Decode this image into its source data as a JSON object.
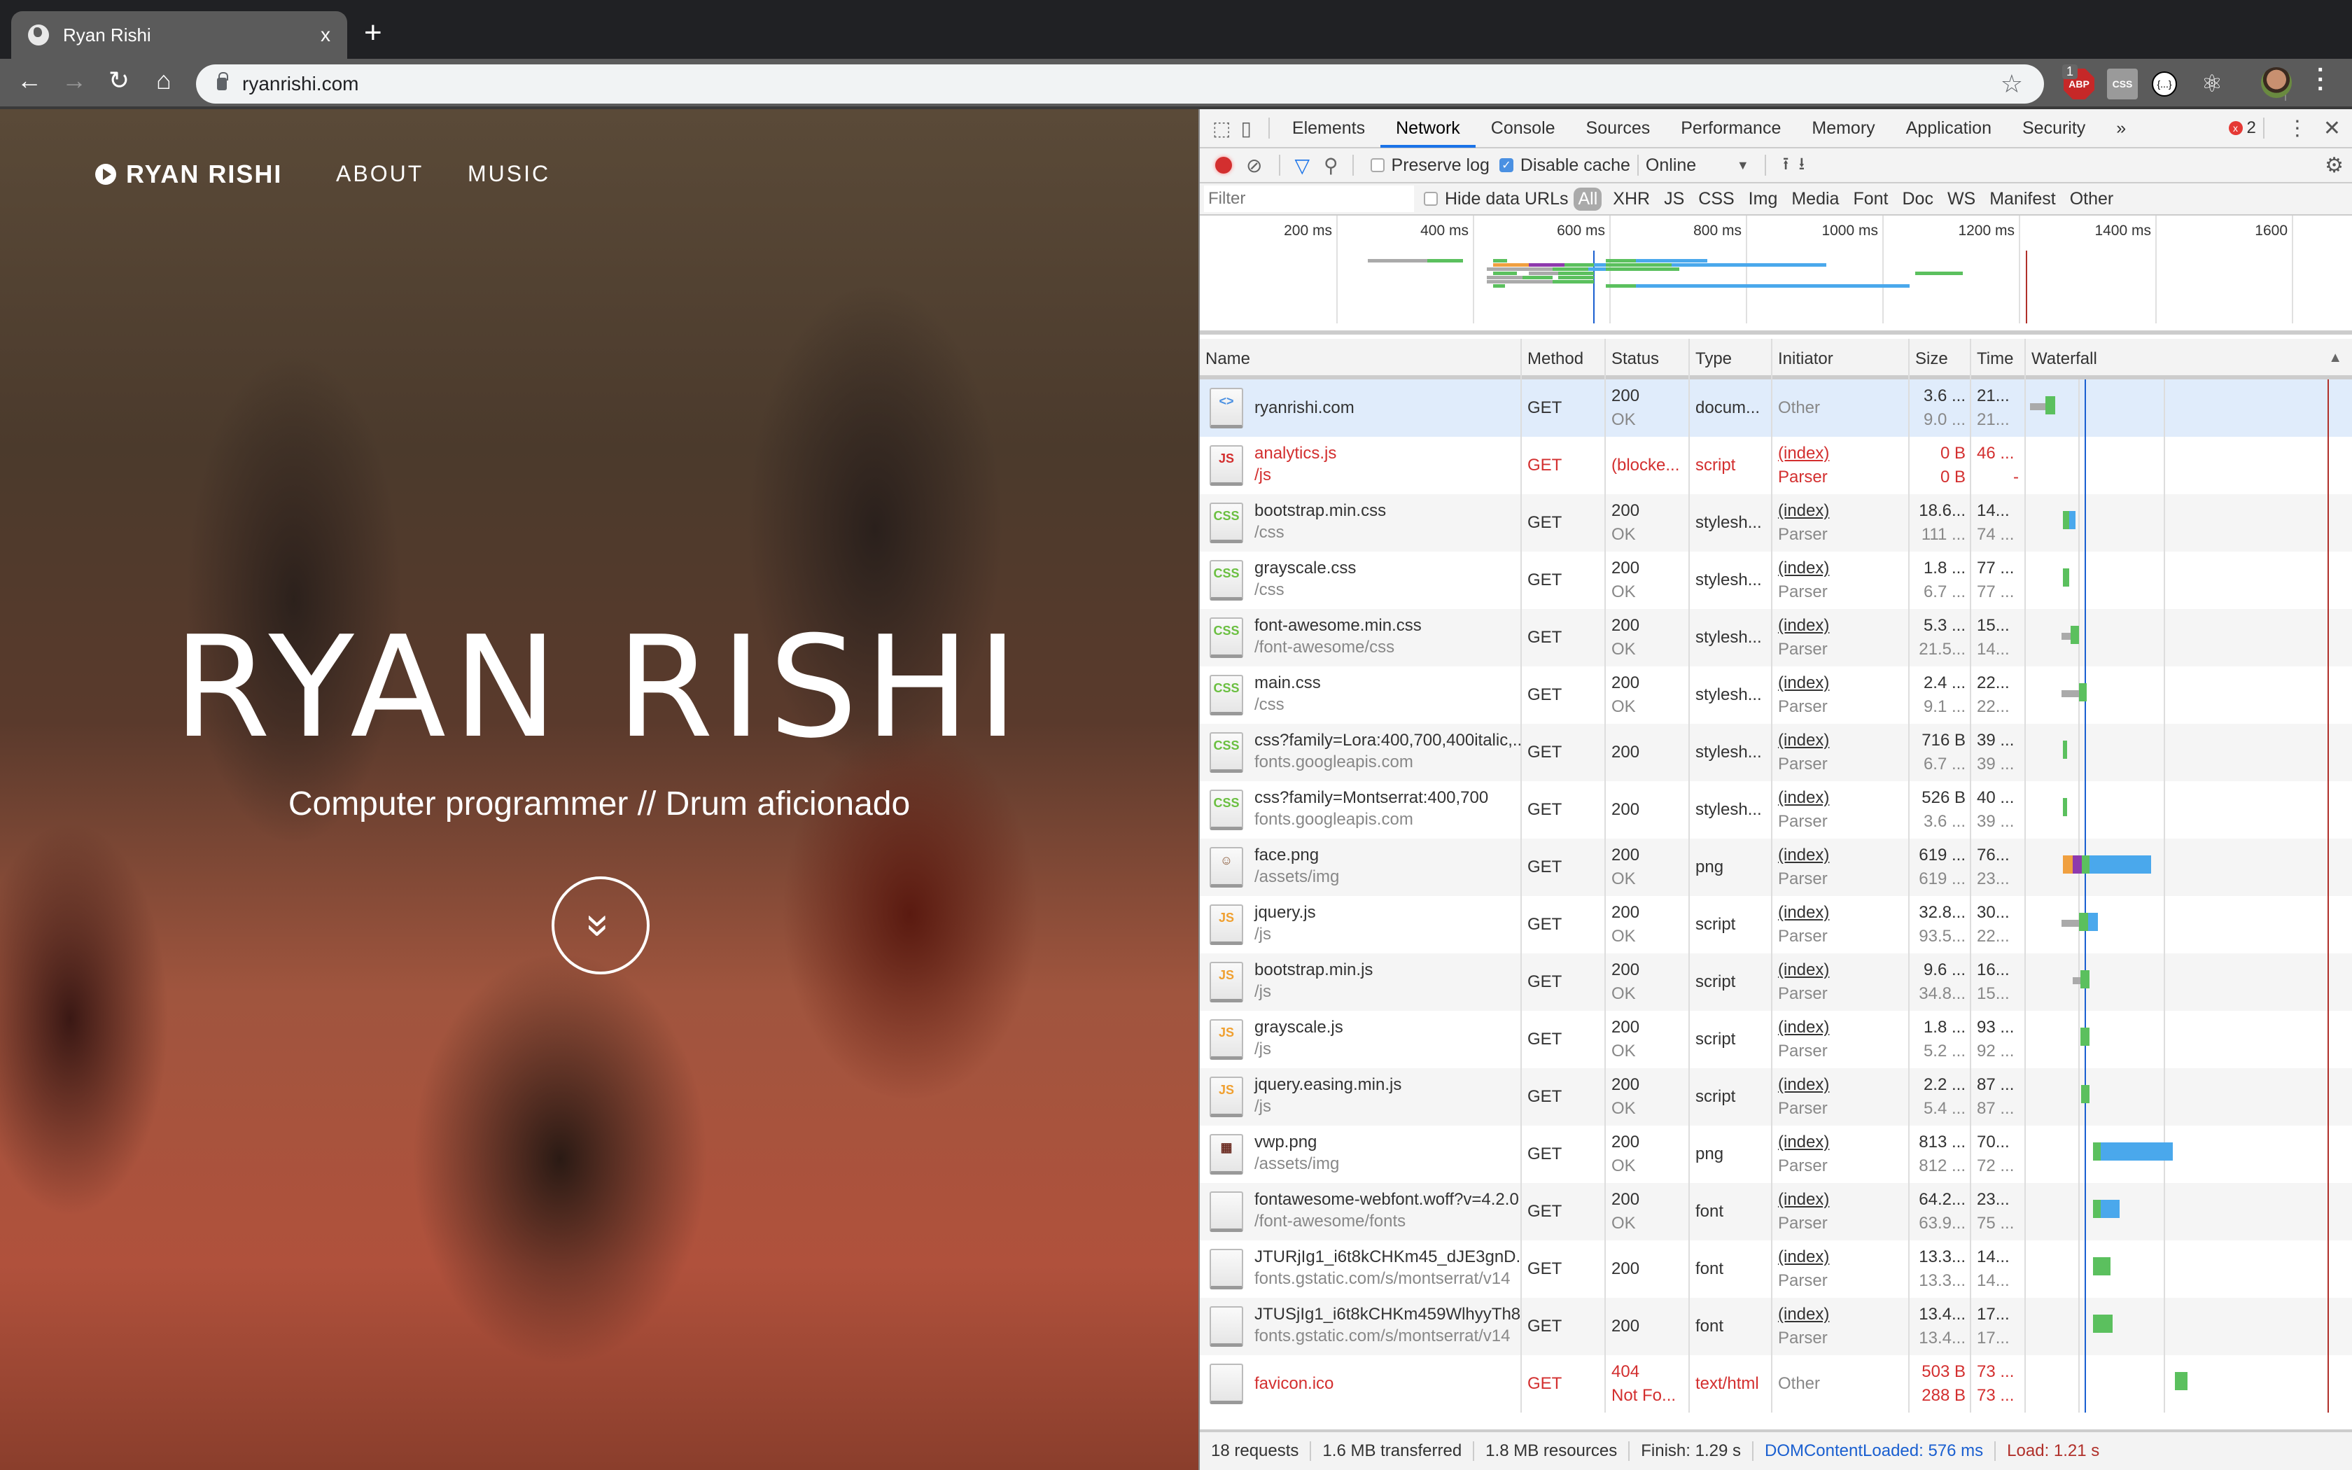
{
  "browser": {
    "tab_title": "Ryan Rishi",
    "new_tab": "+",
    "tab_close": "x",
    "url": "ryanrishi.com",
    "nav": {
      "back": "←",
      "forward": "→",
      "reload": "↻",
      "home": "⌂"
    },
    "extensions": {
      "abp_label": "ABP",
      "abp_badge": "1",
      "css_label": "CSS",
      "json_label": "{...}",
      "react_label": "⚛"
    },
    "bookmark_star": "☆",
    "menu": "⋮"
  },
  "page": {
    "brand": "RYAN RISHI",
    "nav_links": [
      "ABOUT",
      "MUSIC"
    ],
    "hero_title": "RYAN RISHI",
    "hero_subtitle": "Computer programmer // Drum aficionado",
    "scroll_icon": "»"
  },
  "devtools": {
    "tabs": [
      "Elements",
      "Network",
      "Console",
      "Sources",
      "Performance",
      "Memory",
      "Application",
      "Security"
    ],
    "active_tab": "Network",
    "more_tabs": "»",
    "error_count": "2",
    "toolbar": {
      "preserve_log": "Preserve log",
      "preserve_log_checked": false,
      "disable_cache": "Disable cache",
      "disable_cache_checked": true,
      "throttle": "Online"
    },
    "filter": {
      "placeholder": "Filter",
      "hide_data_urls": "Hide data URLs",
      "types": [
        "All",
        "XHR",
        "JS",
        "CSS",
        "Img",
        "Media",
        "Font",
        "Doc",
        "WS",
        "Manifest",
        "Other"
      ],
      "active_type": "All"
    },
    "overview": {
      "ticks": [
        "200 ms",
        "400 ms",
        "600 ms",
        "800 ms",
        "1000 ms",
        "1200 ms",
        "1400 ms",
        "1600"
      ],
      "dom_content_loaded_ms": 576,
      "load_ms": 1210
    },
    "columns": [
      "Name",
      "Method",
      "Status",
      "Type",
      "Initiator",
      "Size",
      "Time",
      "Waterfall"
    ],
    "requests": [
      {
        "name": "ryanrishi.com",
        "path": "",
        "method": "GET",
        "status": "200",
        "status_text": "OK",
        "type": "docum...",
        "initiator": "Other",
        "initiator_sub": "",
        "size": "3.6 ...",
        "size2": "9.0 ...",
        "time": "21...",
        "time2": "21...",
        "icon": "doc",
        "error": false,
        "selected": true,
        "wf": [
          [
            0,
            0.05,
            "#aaa"
          ],
          [
            0.05,
            0.08,
            "#5bc05e"
          ]
        ]
      },
      {
        "name": "analytics.js",
        "path": "/js",
        "method": "GET",
        "status": "(blocke...",
        "status_text": "",
        "type": "script",
        "initiator": "(index)",
        "initiator_sub": "Parser",
        "size": "0 B",
        "size2": "0 B",
        "time": "46 ...",
        "time2": "-",
        "icon": "js",
        "error": true,
        "wf": []
      },
      {
        "name": "bootstrap.min.css",
        "path": "/css",
        "method": "GET",
        "status": "200",
        "status_text": "OK",
        "type": "stylesh...",
        "initiator": "(index)",
        "initiator_sub": "Parser",
        "size": "18.6...",
        "size2": "111 ...",
        "time": "14...",
        "time2": "74 ...",
        "icon": "css",
        "error": false,
        "wf": [
          [
            0.105,
            0.125,
            "#5bc05e"
          ],
          [
            0.125,
            0.145,
            "#4aa8ec"
          ]
        ]
      },
      {
        "name": "grayscale.css",
        "path": "/css",
        "method": "GET",
        "status": "200",
        "status_text": "OK",
        "type": "stylesh...",
        "initiator": "(index)",
        "initiator_sub": "Parser",
        "size": "1.8 ...",
        "size2": "6.7 ...",
        "time": "77 ...",
        "time2": "77 ...",
        "icon": "css",
        "error": false,
        "wf": [
          [
            0.105,
            0.125,
            "#5bc05e"
          ]
        ]
      },
      {
        "name": "font-awesome.min.css",
        "path": "/font-awesome/css",
        "method": "GET",
        "status": "200",
        "status_text": "OK",
        "type": "stylesh...",
        "initiator": "(index)",
        "initiator_sub": "Parser",
        "size": "5.3 ...",
        "size2": "21.5...",
        "time": "15...",
        "time2": "14...",
        "icon": "css",
        "error": false,
        "wf": [
          [
            0.1,
            0.13,
            "#aaa"
          ],
          [
            0.13,
            0.155,
            "#5bc05e"
          ]
        ]
      },
      {
        "name": "main.css",
        "path": "/css",
        "method": "GET",
        "status": "200",
        "status_text": "OK",
        "type": "stylesh...",
        "initiator": "(index)",
        "initiator_sub": "Parser",
        "size": "2.4 ...",
        "size2": "9.1 ...",
        "time": "22...",
        "time2": "22...",
        "icon": "css",
        "error": false,
        "wf": [
          [
            0.1,
            0.155,
            "#aaa"
          ],
          [
            0.155,
            0.18,
            "#5bc05e"
          ]
        ]
      },
      {
        "name": "css?family=Lora:400,700,400italic,...",
        "path": "fonts.googleapis.com",
        "method": "GET",
        "status": "200",
        "status_text": "",
        "type": "stylesh...",
        "initiator": "(index)",
        "initiator_sub": "Parser",
        "size": "716 B",
        "size2": "6.7 ...",
        "time": "39 ...",
        "time2": "39 ...",
        "icon": "css",
        "error": false,
        "wf": [
          [
            0.105,
            0.115,
            "#5bc05e"
          ]
        ]
      },
      {
        "name": "css?family=Montserrat:400,700",
        "path": "fonts.googleapis.com",
        "method": "GET",
        "status": "200",
        "status_text": "",
        "type": "stylesh...",
        "initiator": "(index)",
        "initiator_sub": "Parser",
        "size": "526 B",
        "size2": "3.6 ...",
        "time": "40 ...",
        "time2": "39 ...",
        "icon": "css",
        "error": false,
        "wf": [
          [
            0.105,
            0.117,
            "#5bc05e"
          ]
        ]
      },
      {
        "name": "face.png",
        "path": "/assets/img",
        "method": "GET",
        "status": "200",
        "status_text": "OK",
        "type": "png",
        "initiator": "(index)",
        "initiator_sub": "Parser",
        "size": "619 ...",
        "size2": "619 ...",
        "time": "76...",
        "time2": "23...",
        "icon": "face",
        "error": false,
        "wf": [
          [
            0.105,
            0.135,
            "#f0a040"
          ],
          [
            0.135,
            0.165,
            "#8e3aad"
          ],
          [
            0.165,
            0.19,
            "#5bc05e"
          ],
          [
            0.19,
            0.385,
            "#4aa8ec"
          ]
        ]
      },
      {
        "name": "jquery.js",
        "path": "/js",
        "method": "GET",
        "status": "200",
        "status_text": "OK",
        "type": "script",
        "initiator": "(index)",
        "initiator_sub": "Parser",
        "size": "32.8...",
        "size2": "93.5...",
        "time": "30...",
        "time2": "22...",
        "icon": "js",
        "error": false,
        "wf": [
          [
            0.1,
            0.155,
            "#aaa"
          ],
          [
            0.155,
            0.185,
            "#5bc05e"
          ],
          [
            0.185,
            0.215,
            "#4aa8ec"
          ]
        ]
      },
      {
        "name": "bootstrap.min.js",
        "path": "/js",
        "method": "GET",
        "status": "200",
        "status_text": "OK",
        "type": "script",
        "initiator": "(index)",
        "initiator_sub": "Parser",
        "size": "9.6 ...",
        "size2": "34.8...",
        "time": "16...",
        "time2": "15...",
        "icon": "js",
        "error": false,
        "wf": [
          [
            0.135,
            0.16,
            "#aaa"
          ],
          [
            0.16,
            0.19,
            "#5bc05e"
          ]
        ]
      },
      {
        "name": "grayscale.js",
        "path": "/js",
        "method": "GET",
        "status": "200",
        "status_text": "OK",
        "type": "script",
        "initiator": "(index)",
        "initiator_sub": "Parser",
        "size": "1.8 ...",
        "size2": "5.2 ...",
        "time": "93 ...",
        "time2": "92 ...",
        "icon": "js",
        "error": false,
        "wf": [
          [
            0.16,
            0.19,
            "#5bc05e"
          ]
        ]
      },
      {
        "name": "jquery.easing.min.js",
        "path": "/js",
        "method": "GET",
        "status": "200",
        "status_text": "OK",
        "type": "script",
        "initiator": "(index)",
        "initiator_sub": "Parser",
        "size": "2.2 ...",
        "size2": "5.4 ...",
        "time": "87 ...",
        "time2": "87 ...",
        "icon": "js",
        "error": false,
        "wf": [
          [
            0.163,
            0.19,
            "#5bc05e"
          ]
        ]
      },
      {
        "name": "vwp.png",
        "path": "/assets/img",
        "method": "GET",
        "status": "200",
        "status_text": "OK",
        "type": "png",
        "initiator": "(index)",
        "initiator_sub": "Parser",
        "size": "813 ...",
        "size2": "812 ...",
        "time": "70...",
        "time2": "72 ...",
        "icon": "photo",
        "error": false,
        "wf": [
          [
            0.2,
            0.225,
            "#5bc05e"
          ],
          [
            0.225,
            0.455,
            "#4aa8ec"
          ]
        ]
      },
      {
        "name": "fontawesome-webfont.woff?v=4.2.0",
        "path": "/font-awesome/fonts",
        "method": "GET",
        "status": "200",
        "status_text": "OK",
        "type": "font",
        "initiator": "(index)",
        "initiator_sub": "Parser",
        "size": "64.2...",
        "size2": "63.9...",
        "time": "23...",
        "time2": "75 ...",
        "icon": "blank",
        "error": false,
        "wf": [
          [
            0.2,
            0.225,
            "#5bc05e"
          ],
          [
            0.225,
            0.285,
            "#4aa8ec"
          ]
        ]
      },
      {
        "name": "JTURjIg1_i6t8kCHKm45_dJE3gnD...",
        "path": "fonts.gstatic.com/s/montserrat/v14",
        "method": "GET",
        "status": "200",
        "status_text": "",
        "type": "font",
        "initiator": "(index)",
        "initiator_sub": "Parser",
        "size": "13.3...",
        "size2": "13.3...",
        "time": "14...",
        "time2": "14...",
        "icon": "blank",
        "error": false,
        "wf": [
          [
            0.2,
            0.255,
            "#5bc05e"
          ]
        ]
      },
      {
        "name": "JTUSjIg1_i6t8kCHKm459WlhyyTh8...",
        "path": "fonts.gstatic.com/s/montserrat/v14",
        "method": "GET",
        "status": "200",
        "status_text": "",
        "type": "font",
        "initiator": "(index)",
        "initiator_sub": "Parser",
        "size": "13.4...",
        "size2": "13.4...",
        "time": "17...",
        "time2": "17...",
        "icon": "blank",
        "error": false,
        "wf": [
          [
            0.2,
            0.262,
            "#5bc05e"
          ]
        ]
      },
      {
        "name": "favicon.ico",
        "path": "",
        "method": "GET",
        "status": "404",
        "status_text": "Not Fo...",
        "type": "text/html",
        "initiator": "Other",
        "initiator_sub": "",
        "size": "503 B",
        "size2": "288 B",
        "time": "73 ...",
        "time2": "73 ...",
        "icon": "blank",
        "error": true,
        "wf": [
          [
            0.46,
            0.5,
            "#5bc05e"
          ]
        ]
      }
    ],
    "summary": {
      "requests": "18 requests",
      "transferred": "1.6 MB transferred",
      "resources": "1.8 MB resources",
      "finish": "Finish: 1.29 s",
      "dom_content_loaded": "DOMContentLoaded: 576 ms",
      "load": "Load: 1.21 s"
    },
    "colors": {
      "dcl": "#1a5fd0",
      "load": "#b0302a",
      "accent": "#1a73e8"
    }
  }
}
